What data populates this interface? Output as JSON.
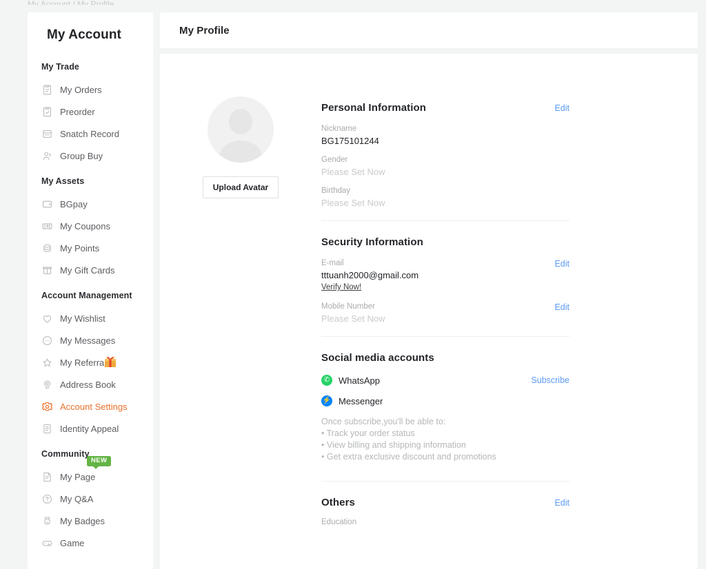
{
  "breadcrumb": {
    "text": "My Account / My Profile"
  },
  "sidebar": {
    "title": "My Account",
    "groups": [
      {
        "title": "My Trade",
        "items": [
          {
            "label": "My Orders",
            "icon": "clipboard-icon",
            "active": false
          },
          {
            "label": "Preorder",
            "icon": "clipboard-check-icon",
            "active": false
          },
          {
            "label": "Snatch Record",
            "icon": "snatch-icon",
            "active": false
          },
          {
            "label": "Group Buy",
            "icon": "group-icon",
            "active": false
          }
        ]
      },
      {
        "title": "My Assets",
        "items": [
          {
            "label": "BGpay",
            "icon": "wallet-icon",
            "active": false
          },
          {
            "label": "My Coupons",
            "icon": "coupon-icon",
            "active": false
          },
          {
            "label": "My Points",
            "icon": "coins-icon",
            "active": false
          },
          {
            "label": "My Gift Cards",
            "icon": "giftcard-icon",
            "active": false
          }
        ]
      },
      {
        "title": "Account Management",
        "items": [
          {
            "label": "My Wishlist",
            "icon": "heart-icon",
            "active": false
          },
          {
            "label": "My Messages",
            "icon": "message-icon",
            "active": false
          },
          {
            "label": "My Referrals",
            "icon": "star-icon",
            "active": false,
            "badge": "gift"
          },
          {
            "label": "Address Book",
            "icon": "location-icon",
            "active": false
          },
          {
            "label": "Account Settings",
            "icon": "gear-icon",
            "active": true
          },
          {
            "label": "Identity Appeal",
            "icon": "document-icon",
            "active": false
          }
        ]
      },
      {
        "title": "Community",
        "items": [
          {
            "label": "My Page",
            "icon": "page-icon",
            "active": false,
            "badge": "NEW"
          },
          {
            "label": "My Q&A",
            "icon": "question-icon",
            "active": false
          },
          {
            "label": "My Badges",
            "icon": "badge-icon",
            "active": false
          },
          {
            "label": "Game",
            "icon": "game-icon",
            "active": false
          }
        ]
      }
    ]
  },
  "main": {
    "header_title": "My Profile",
    "avatar": {
      "upload_label": "Upload Avatar"
    },
    "personal": {
      "title": "Personal Information",
      "edit_label": "Edit",
      "fields": [
        {
          "label": "Nickname",
          "value": "BG175101244",
          "empty": false
        },
        {
          "label": "Gender",
          "value": "Please Set Now",
          "empty": true
        },
        {
          "label": "Birthday",
          "value": "Please Set Now",
          "empty": true
        }
      ]
    },
    "security": {
      "title": "Security Information",
      "email_label": "E-mail",
      "email_value": "tttuanh2000@gmail.com",
      "email_edit_label": "Edit",
      "verify_label": "Verify Now!",
      "mobile_label": "Mobile Number",
      "mobile_value": "Please Set Now",
      "mobile_edit_label": "Edit"
    },
    "social": {
      "title": "Social media accounts",
      "whatsapp_label": "WhatsApp",
      "subscribe_label": "Subscribe",
      "messenger_label": "Messenger",
      "benefits_intro": "Once subscribe,you'll be able to:",
      "benefits": [
        "• Track your order status",
        "• View billing and shipping information",
        "• Get extra exclusive discount and promotions"
      ]
    },
    "others": {
      "title": "Others",
      "edit_label": "Edit",
      "education_label": "Education"
    }
  },
  "colors": {
    "accent_orange": "#e8702a",
    "link_blue": "#5b9bf3",
    "badge_green": "#64b445",
    "whatsapp_green": "#25d366",
    "messenger_blue": "#0084ff"
  }
}
